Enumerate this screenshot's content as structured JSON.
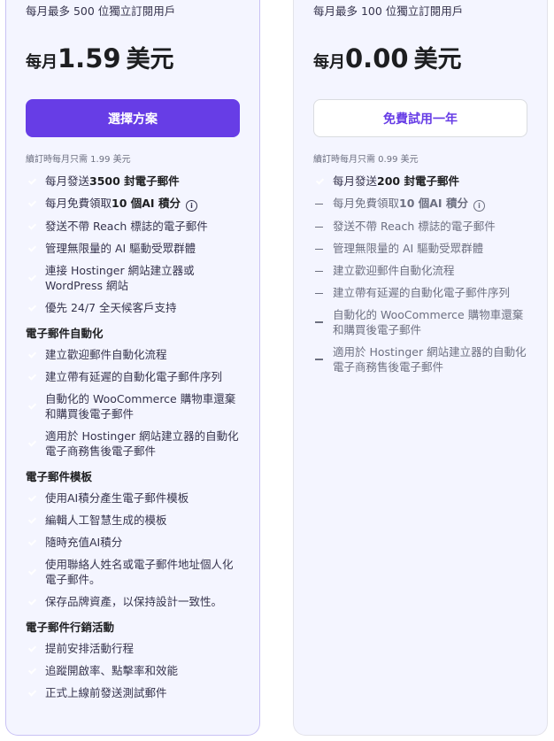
{
  "left": {
    "subtitle": "每月最多 500 位獨立訂閱用戶",
    "price_prefix": "每月",
    "price_amount": "1.59",
    "price_unit": "美元",
    "cta": "選擇方案",
    "renew": "續訂時每月只需 1.99 美元",
    "features": [
      {
        "pre": "每月發送",
        "bold": "3500 封電子郵件",
        "post": ""
      },
      {
        "pre": "每月免費領取",
        "bold": "10 個AI 積分",
        "post": "",
        "info": "i"
      },
      {
        "pre": "發送不帶 Reach 標誌的電子郵件",
        "bold": "",
        "post": ""
      },
      {
        "pre": "管理無限量的 AI 驅動受眾群體",
        "bold": "",
        "post": ""
      },
      {
        "pre": "連接 Hostinger 網站建立器或 WordPress 網站",
        "bold": "",
        "post": ""
      },
      {
        "pre": "優先 24/7 全天候客戶支持",
        "bold": "",
        "post": ""
      }
    ],
    "sections": [
      {
        "title": "電子郵件自動化",
        "items": [
          "建立歡迎郵件自動化流程",
          "建立帶有延遲的自動化電子郵件序列",
          "自動化的 WooCommerce 購物車還棄和購買後電子郵件",
          "適用於 Hostinger 網站建立器的自動化電子商務售後電子郵件"
        ]
      },
      {
        "title": "電子郵件模板",
        "items": [
          "使用AI積分產生電子郵件模板",
          "編輯人工智慧生成的模板",
          "隨時充值AI積分",
          "使用聯絡人姓名或電子郵件地址個人化電子郵件。",
          "保存品牌資產，以保持設計一致性。"
        ]
      },
      {
        "title": "電子郵件行銷活動",
        "items": [
          "提前安排活動行程",
          "追蹤開啟率、點擊率和效能",
          "正式上線前發送測試郵件"
        ]
      }
    ]
  },
  "right": {
    "subtitle": "每月最多 100 位獨立訂閱用戶",
    "price_prefix": "每月",
    "price_amount": "0.00",
    "price_unit": "美元",
    "cta": "免費試用一年",
    "renew": "續訂時每月只需 0.99 美元",
    "features": [
      {
        "pre": "每月發送",
        "bold": "200 封電子郵件",
        "post": "",
        "included": true
      },
      {
        "pre": "每月免費領取",
        "bold": "10 個AI 積分",
        "post": "",
        "info": "i",
        "included": false
      },
      {
        "pre": "發送不帶 Reach 標誌的電子郵件",
        "bold": "",
        "post": "",
        "included": false
      },
      {
        "pre": "管理無限量的 AI 驅動受眾群體",
        "bold": "",
        "post": "",
        "included": false
      },
      {
        "pre": "建立歡迎郵件自動化流程",
        "bold": "",
        "post": "",
        "included": false
      },
      {
        "pre": "建立帶有延遲的自動化電子郵件序列",
        "bold": "",
        "post": "",
        "included": false
      },
      {
        "pre": "自動化的 WooCommerce 購物車還棄和購買後電子郵件",
        "bold": "",
        "post": "",
        "included": false
      },
      {
        "pre": "適用於 Hostinger 網站建立器的自動化電子商務售後電子郵件",
        "bold": "",
        "post": "",
        "included": false
      }
    ]
  },
  "icons": {
    "included": "check-circle-icon",
    "excluded": "dash-icon",
    "info": "info-icon"
  },
  "colors": {
    "primary": "#673de6",
    "check": "#00b090",
    "card_bg": "#f4f5ff",
    "text": "#36344d"
  }
}
